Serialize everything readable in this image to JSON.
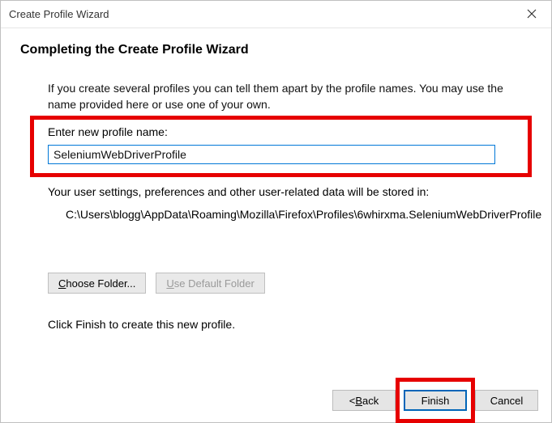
{
  "window": {
    "title": "Create Profile Wizard"
  },
  "heading": "Completing the Create Profile Wizard",
  "intro": "If you create several profiles you can tell them apart by the profile names. You may use the name provided here or use one of your own.",
  "name_label": "Enter new profile name:",
  "name_value": "SeleniumWebDriverProfile",
  "storage_text": "Your user settings, preferences and other user-related data will be stored in:",
  "storage_path": "C:\\Users\\blogg\\AppData\\Roaming\\Mozilla\\Firefox\\Profiles\\6whirxma.SeleniumWebDriverProfile",
  "choose_folder_label": "Choose Folder...",
  "choose_folder_accesskey": "C",
  "use_default_label": "Use Default Folder",
  "use_default_accesskey": "U",
  "finish_hint": "Click Finish to create this new profile.",
  "back_label": "< Back",
  "back_accesskey": "B",
  "finish_label": "Finish",
  "cancel_label": "Cancel"
}
